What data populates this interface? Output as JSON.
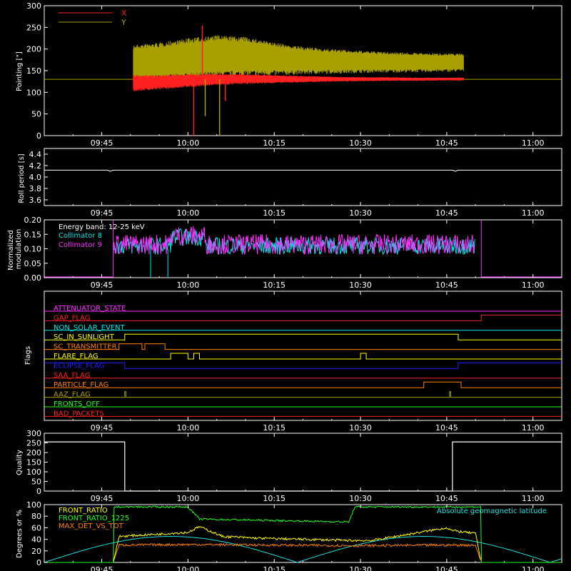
{
  "time_axis": {
    "ticks": [
      "09:45",
      "10:00",
      "10:15",
      "10:30",
      "10:45",
      "11:00"
    ],
    "tick_minutes": [
      585,
      600,
      615,
      630,
      645,
      660
    ],
    "xlim_minutes": [
      575,
      665
    ]
  },
  "chart_data": [
    {
      "type": "line",
      "panel": "pointing",
      "ylabel": "Pointing [\"]",
      "ylim": [
        0,
        300
      ],
      "yticks": [
        0,
        50,
        100,
        150,
        200,
        250,
        300
      ],
      "legend": [
        "X",
        "Y"
      ],
      "series": [
        {
          "name": "X",
          "color": "#ff2020",
          "kind": "band",
          "x": [
            590.5,
            595,
            600,
            605,
            610,
            615,
            620,
            625,
            630,
            635,
            640,
            645,
            648
          ],
          "low": [
            100,
            105,
            110,
            115,
            118,
            120,
            122,
            124,
            125,
            126,
            126,
            127,
            127
          ],
          "high": [
            140,
            140,
            142,
            143,
            142,
            140,
            138,
            136,
            135,
            135,
            134,
            134,
            134
          ]
        },
        {
          "name": "Y",
          "color": "#a8a000",
          "kind": "band",
          "x": [
            590.5,
            595,
            600,
            605,
            610,
            615,
            620,
            625,
            630,
            635,
            640,
            645,
            648
          ],
          "low": [
            120,
            122,
            125,
            128,
            132,
            135,
            138,
            140,
            142,
            143,
            144,
            145,
            146
          ],
          "high": [
            210,
            215,
            225,
            232,
            228,
            215,
            205,
            200,
            196,
            193,
            191,
            190,
            190
          ]
        }
      ],
      "spikes": [
        {
          "color": "#ff2020",
          "x": 601,
          "to": 0
        },
        {
          "color": "#ff2020",
          "x": 602.5,
          "to": 255
        },
        {
          "color": "#a8a000",
          "x": 603,
          "to": 45
        },
        {
          "color": "#a8a000",
          "x": 605.5,
          "to": 0
        },
        {
          "color": "#ff2020",
          "x": 606.5,
          "to": 80
        }
      ],
      "reference_line": 130
    },
    {
      "type": "line",
      "panel": "roll",
      "ylabel": "Roll period [s]",
      "ylim": [
        3.5,
        4.5
      ],
      "yticks": [
        "3.6",
        "3.8",
        "4.0",
        "4.2",
        "4.4"
      ],
      "series": [
        {
          "color": "#ffffff",
          "x": [
            575,
            586,
            586.5,
            587,
            646,
            646.5,
            647,
            665
          ],
          "values": [
            4.12,
            4.12,
            4.1,
            4.12,
            4.12,
            4.1,
            4.12,
            4.12
          ]
        }
      ]
    },
    {
      "type": "line",
      "panel": "modulation",
      "ylabel": "Normalized modulation",
      "ylim": [
        0,
        0.2
      ],
      "yticks": [
        "0.00",
        "0.05",
        "0.10",
        "0.15",
        "0.20"
      ],
      "legend_title": "Energy band: 12-25 keV",
      "series": [
        {
          "name": "Collimator 8",
          "color": "#00e5e5",
          "x_range": [
            587,
            650
          ],
          "base": 0.11,
          "noise": 0.03
        },
        {
          "name": "Collimator 9",
          "color": "#ff30ff",
          "x_range": [
            587,
            650
          ],
          "base": 0.115,
          "noise": 0.035
        }
      ],
      "drops": [
        {
          "color": "#00e5e5",
          "x": 593.5
        },
        {
          "color": "#00e5e5",
          "x": 596.5
        }
      ],
      "edges": [
        587,
        651
      ]
    },
    {
      "type": "line",
      "panel": "flags",
      "ylabel": "Flags",
      "flags": [
        {
          "label": "ATTENUATOR_STATE",
          "color": "#ff30ff",
          "x": [
            575,
            665
          ],
          "v": [
            0,
            0
          ]
        },
        {
          "label": "GAP_FLAG",
          "color": "#ff2020",
          "x": [
            575,
            651,
            651,
            665
          ],
          "v": [
            0,
            0,
            1,
            1
          ]
        },
        {
          "label": "NON_SOLAR_EVENT",
          "color": "#00e5e5",
          "x": [
            575,
            665
          ],
          "v": [
            0,
            0
          ]
        },
        {
          "label": "SC_IN_SUNLIGHT",
          "color": "#ffff00",
          "x": [
            575,
            589,
            589,
            647,
            647,
            665
          ],
          "v": [
            0,
            0,
            1,
            1,
            0,
            0
          ]
        },
        {
          "label": "SC_TRANSMITTER",
          "color": "#ff8000",
          "x": [
            575,
            588,
            588,
            592,
            592,
            592.5,
            592.5,
            596,
            596,
            665
          ],
          "v": [
            0,
            0,
            1,
            1,
            0,
            0,
            1,
            1,
            0,
            0
          ]
        },
        {
          "label": "FLARE_FLAG",
          "color": "#ffff00",
          "x": [
            575,
            597,
            597,
            600,
            600,
            601,
            601,
            602,
            602,
            630,
            630,
            631,
            631,
            665
          ],
          "v": [
            0,
            0,
            1,
            1,
            0,
            0,
            1,
            1,
            0,
            0,
            1,
            1,
            0,
            0
          ]
        },
        {
          "label": "ECLIPSE_FLAG",
          "color": "#2020ff",
          "x": [
            575,
            589,
            589,
            647,
            647,
            665
          ],
          "v": [
            1,
            1,
            0,
            0,
            1,
            1
          ]
        },
        {
          "label": "SAA_FLAG",
          "color": "#ff2020",
          "x": [
            575,
            665
          ],
          "v": [
            0,
            0
          ]
        },
        {
          "label": "PARTICLE_FLAG",
          "color": "#ff8000",
          "x": [
            575,
            641,
            641,
            647.5,
            647.5,
            665
          ],
          "v": [
            0,
            0,
            1,
            1,
            0,
            0
          ]
        },
        {
          "label": "AAZ_FLAG",
          "color": "#a8a000",
          "x": [
            575,
            589,
            589,
            589.2,
            589.2,
            645.5,
            645.5,
            645.7,
            645.7,
            665
          ],
          "v": [
            0,
            0,
            1,
            1,
            0,
            0,
            1,
            1,
            0,
            0
          ]
        },
        {
          "label": "FRONTS_OFF",
          "color": "#20ff20",
          "x": [
            575,
            665
          ],
          "v": [
            0,
            0
          ]
        },
        {
          "label": "BAD_PACKETS",
          "color": "#ff2020",
          "x": [
            575,
            665
          ],
          "v": [
            0,
            0
          ]
        }
      ]
    },
    {
      "type": "line",
      "panel": "quality",
      "ylabel": "Quality",
      "ylim": [
        0,
        300
      ],
      "yticks": [
        0,
        50,
        100,
        150,
        200,
        250,
        300
      ],
      "series": [
        {
          "color": "#ffffff",
          "x": [
            575,
            589,
            589,
            646,
            646,
            665
          ],
          "values": [
            255,
            255,
            0,
            0,
            255,
            255
          ]
        }
      ]
    },
    {
      "type": "line",
      "panel": "ratios",
      "ylabel": "Degrees or %",
      "ylim": [
        0,
        100
      ],
      "yticks": [
        0,
        20,
        40,
        60,
        80,
        100
      ],
      "legend": [
        "FRONT_RATIO",
        "FRONT_RATIO_1225",
        "MAX_DET_VS_TOT"
      ],
      "right_label": "Absolute geomagnetic latitude",
      "series": [
        {
          "name": "FRONT_RATIO",
          "color": "#ffff00",
          "x": [
            587,
            588,
            600,
            602,
            606,
            612,
            620,
            628,
            632,
            645,
            646,
            650,
            651
          ],
          "values": [
            0,
            45,
            52,
            62,
            45,
            42,
            40,
            38,
            38,
            60,
            55,
            50,
            0
          ]
        },
        {
          "name": "FRONT_RATIO_1225",
          "color": "#20ff20",
          "x": [
            575,
            587,
            587,
            600,
            602,
            628,
            629,
            651,
            651,
            665
          ],
          "values": [
            0,
            0,
            96,
            96,
            75,
            70,
            96,
            96,
            0,
            0
          ]
        },
        {
          "name": "MAX_DET_VS_TOT",
          "color": "#ff8000",
          "x": [
            587,
            588,
            600,
            615,
            630,
            645,
            650,
            651
          ],
          "values": [
            0,
            30,
            31,
            30,
            29,
            30,
            30,
            0
          ]
        },
        {
          "name": "Absolute geomagnetic latitude",
          "color": "#20e0e0",
          "x": [
            575,
            597,
            619,
            641,
            663
          ],
          "values": [
            0,
            45,
            0,
            45,
            0
          ]
        }
      ]
    }
  ]
}
